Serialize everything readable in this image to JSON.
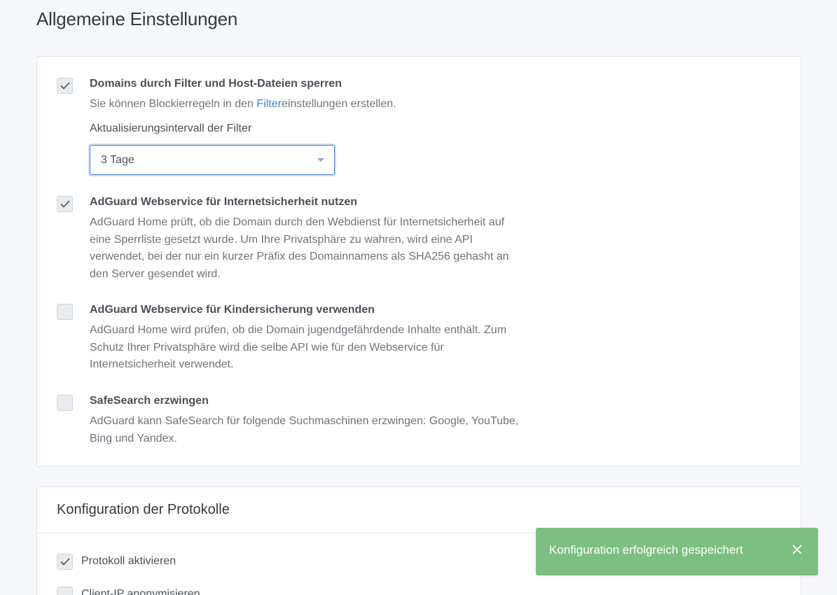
{
  "page": {
    "title": "Allgemeine Einstellungen"
  },
  "filtering": {
    "block_domains": {
      "checked": true,
      "title": "Domains durch Filter und Host-Dateien sperren",
      "desc_prefix": "Sie können Blockierregeln in den ",
      "desc_link": "Filter",
      "desc_suffix": "einstellungen erstellen."
    },
    "interval": {
      "label": "Aktualisierungsintervall der Filter",
      "selected": "3 Tage"
    },
    "safebrowsing": {
      "checked": true,
      "title": "AdGuard Webservice für Internetsicherheit nutzen",
      "desc": "AdGuard Home prüft, ob die Domain durch den Webdienst für Internetsicherheit auf eine Sperrliste gesetzt wurde. Um Ihre Privatsphäre zu wahren, wird eine API verwendet, bei der nur ein kurzer Präfix des Domainnamens als SHA256 gehasht an den Server gesendet wird."
    },
    "parental": {
      "checked": false,
      "title": "AdGuard Webservice für Kindersicherung verwenden",
      "desc": "AdGuard Home wird prüfen, ob die Domain jugendgefährdende Inhalte enthält. Zum Schutz Ihrer Privatsphäre wird die selbe API wie für den Webservice für Internetsicherheit verwendet."
    },
    "safesearch": {
      "checked": false,
      "title": "SafeSearch erzwingen",
      "desc": "AdGuard kann SafeSearch für folgende Suchmaschinen erzwingen: Google, YouTube, Bing und Yandex."
    }
  },
  "log_config": {
    "title": "Konfiguration der Protokolle",
    "enable": {
      "checked": true,
      "label": "Protokoll aktivieren"
    },
    "anonymize": {
      "checked": false,
      "label": "Client-IP anonymisieren"
    }
  },
  "toast": {
    "message": "Konfiguration erfolgreich gespeichert",
    "color": "#7dbf82"
  },
  "colors": {
    "accent": "#467fcf",
    "background": "#f5f7fb"
  }
}
